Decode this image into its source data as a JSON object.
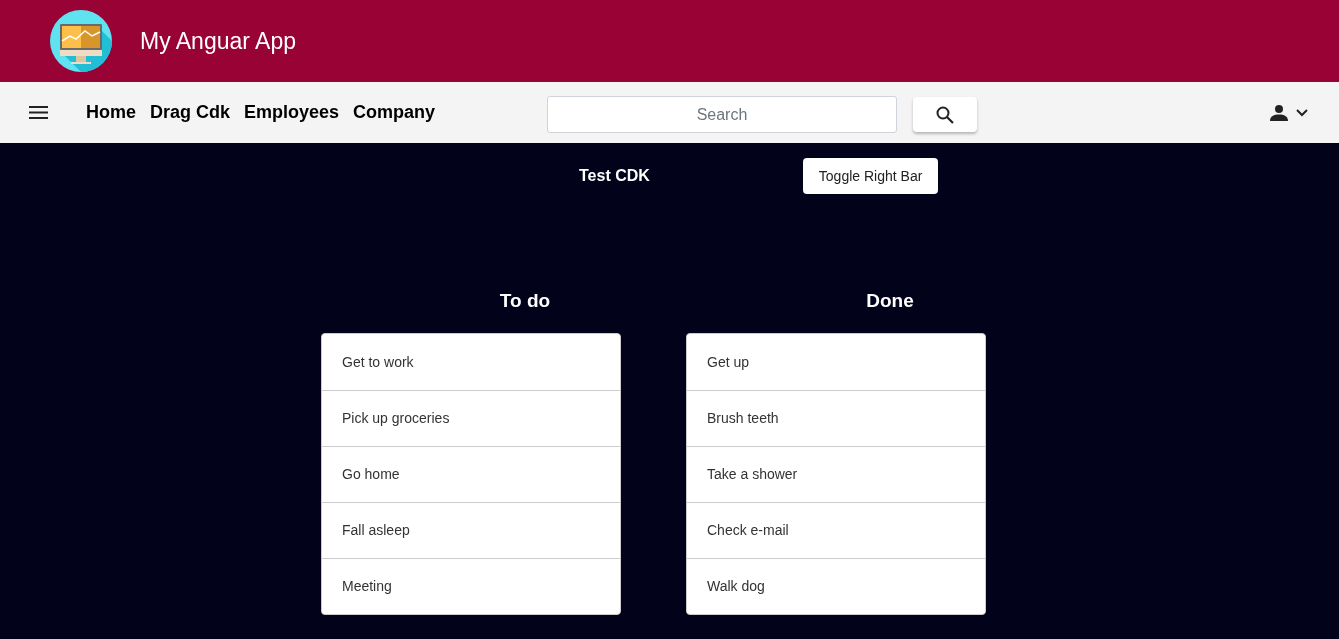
{
  "header": {
    "title": "My Anguar App"
  },
  "navbar": {
    "links": [
      "Home",
      "Drag Cdk",
      "Employees",
      "Company"
    ],
    "search": {
      "placeholder": "Search"
    }
  },
  "page": {
    "title": "Test CDK",
    "toggle_button": "Toggle Right Bar"
  },
  "lists": [
    {
      "title": "To do",
      "items": [
        "Get to work",
        "Pick up groceries",
        "Go home",
        "Fall asleep",
        "Meeting"
      ]
    },
    {
      "title": "Done",
      "items": [
        "Get up",
        "Brush teeth",
        "Take a shower",
        "Check e-mail",
        "Walk dog"
      ]
    }
  ]
}
